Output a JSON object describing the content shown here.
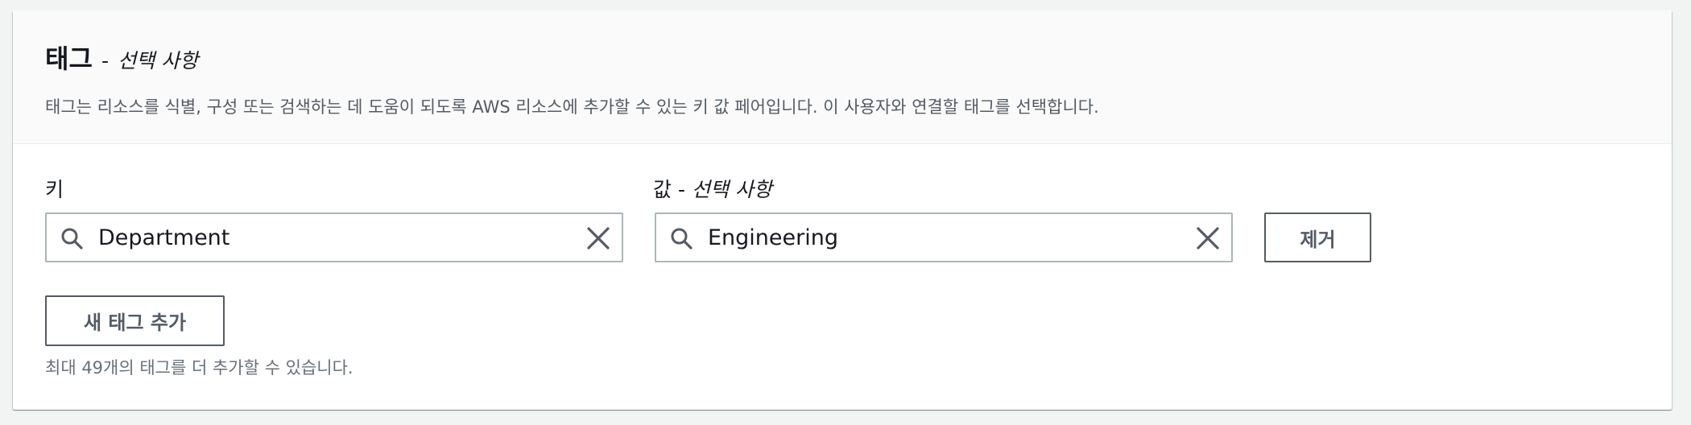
{
  "header": {
    "title": "태그",
    "title_separator": "-",
    "title_optional": "선택 사항",
    "description": "태그는 리소스를 식별, 구성 또는 검색하는 데 도움이 되도록 AWS 리소스에 추가할 수 있는 키 값 페어입니다. 이 사용자와 연결할 태그를 선택합니다."
  },
  "tag_row": {
    "key_label": "키",
    "value_label": "값",
    "value_label_separator": "-",
    "value_label_optional": "선택 사항",
    "key_value": "Department",
    "value_value": "Engineering",
    "remove_label": "제거"
  },
  "footer": {
    "add_tag_label": "새 태그 추가",
    "hint": "최대 49개의 태그를 더 추가할 수 있습니다."
  },
  "icons": {
    "search": "search-icon",
    "clear": "close-icon"
  },
  "colors": {
    "text_primary": "#16191f",
    "text_secondary": "#545b64",
    "border": "#aab7b8",
    "header_bg": "#fafafa",
    "page_bg": "#f2f3f3"
  }
}
